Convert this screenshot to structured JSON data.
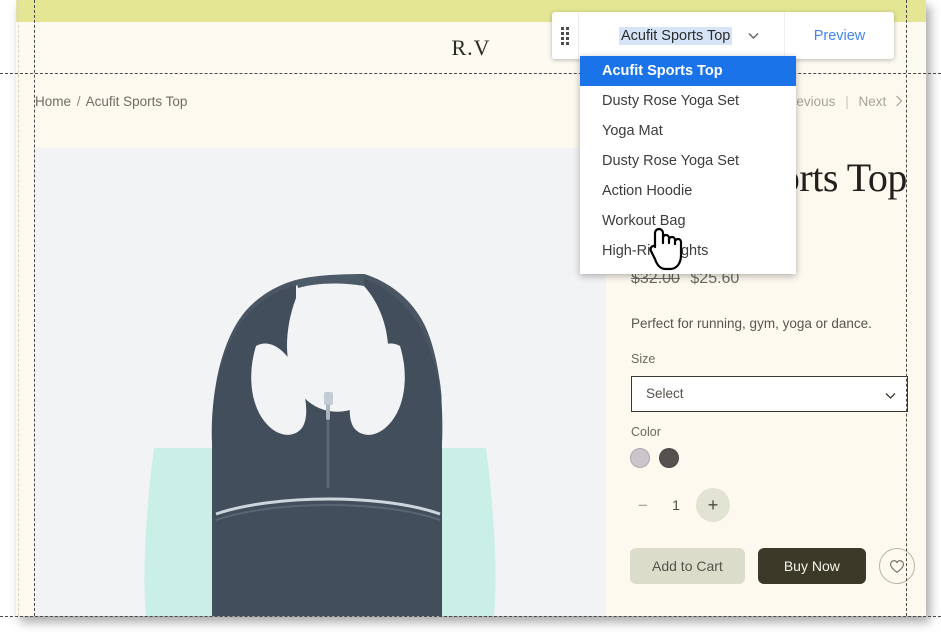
{
  "editor": {
    "drag_handle_icon": "drag-dots-icon",
    "product_picker": {
      "selected": "Acufit Sports Top",
      "chevron_icon": "chevron-down-icon",
      "options": [
        "Acufit Sports Top",
        "Dusty Rose Yoga Set",
        "Yoga Mat",
        "Dusty Rose Yoga Set",
        "Action Hoodie",
        "Workout Bag",
        "High-Rise Tights"
      ],
      "selected_index": 0
    },
    "preview_label": "Preview",
    "accent_blue": "#1a73e8",
    "link_blue": "#4285f4"
  },
  "site": {
    "logo": "R.V",
    "promo_strip_color": "#e4e694",
    "background_color": "#fdf9ef",
    "breadcrumb": {
      "home": "Home",
      "separator": "/",
      "current": "Acufit Sports Top"
    },
    "product_nav": {
      "previous": "Previous",
      "separator": "|",
      "next": "Next",
      "next_chevron_icon": "chevron-right-icon"
    }
  },
  "product": {
    "title": "Acufit Sports Top",
    "price_old": "$32.00",
    "price_new": "$25.60",
    "description": "Perfect for running, gym, yoga or dance.",
    "size": {
      "label": "Size",
      "placeholder": "Select",
      "chevron_icon": "chevron-down-icon"
    },
    "color": {
      "label": "Color",
      "swatches": [
        {
          "name": "light-lilac",
          "hex": "#c9c5cb"
        },
        {
          "name": "charcoal",
          "hex": "#55514f"
        }
      ]
    },
    "quantity": {
      "minus_icon": "minus-icon",
      "value": "1",
      "plus_icon": "plus-icon"
    },
    "actions": {
      "add_to_cart": "Add to Cart",
      "buy_now": "Buy Now",
      "wishlist_icon": "heart-icon"
    },
    "photo": {
      "alt": "dark slate racerback sports top with mint side panels",
      "background": "#f2f3f5",
      "fabric_color": "#3f4b59",
      "panel_color": "#c6efe6"
    }
  }
}
